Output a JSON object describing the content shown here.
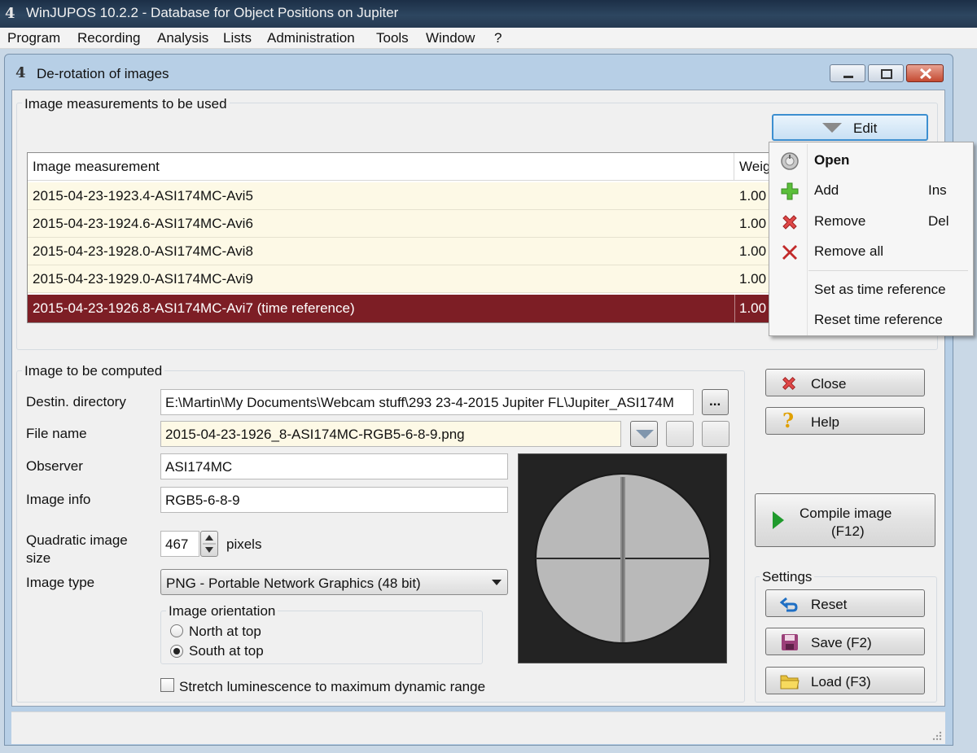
{
  "app": {
    "title": "WinJUPOS 10.2.2 - Database for Object Positions on Jupiter"
  },
  "menubar": [
    "Program",
    "Recording",
    "Analysis",
    "Lists",
    "Administration",
    "Tools",
    "Window",
    "?"
  ],
  "window": {
    "title": "De-rotation of images"
  },
  "measurements": {
    "group_title": "Image measurements to be used",
    "edit_label": "Edit",
    "columns": [
      "Image measurement",
      "Weig"
    ],
    "rows": [
      {
        "name": "2015-04-23-1923.4-ASI174MC-Avi5",
        "weight": "1.00"
      },
      {
        "name": "2015-04-23-1924.6-ASI174MC-Avi6",
        "weight": "1.00"
      },
      {
        "name": "2015-04-23-1928.0-ASI174MC-Avi8",
        "weight": "1.00"
      },
      {
        "name": "2015-04-23-1929.0-ASI174MC-Avi9",
        "weight": "1.00"
      },
      {
        "name": "2015-04-23-1926.8-ASI174MC-Avi7  (time reference)",
        "weight": "1.00"
      }
    ]
  },
  "edit_menu": {
    "items": [
      {
        "label": "Open",
        "shortcut": "",
        "icon": "open-icon"
      },
      {
        "label": "Add",
        "shortcut": "Ins",
        "icon": "plus-icon"
      },
      {
        "label": "Remove",
        "shortcut": "Del",
        "icon": "remove-icon"
      },
      {
        "label": "Remove all",
        "shortcut": "",
        "icon": "remove-all-icon"
      },
      {
        "label": "Set as time reference",
        "shortcut": ""
      },
      {
        "label": "Reset time reference",
        "shortcut": ""
      }
    ]
  },
  "compute": {
    "group_title": "Image to be computed",
    "destin_label": "Destin. directory",
    "destin_value": "E:\\Martin\\My Documents\\Webcam stuff\\293 23-4-2015 Jupiter FL\\Jupiter_ASI174M",
    "browse_label": "...",
    "filename_label": "File name",
    "filename_value": "2015-04-23-1926_8-ASI174MC-RGB5-6-8-9.png",
    "observer_label": "Observer",
    "observer_value": "ASI174MC",
    "imageinfo_label": "Image info",
    "imageinfo_value": "RGB5-6-8-9",
    "size_label_1": "Quadratic image",
    "size_label_2": "size",
    "size_value": "467",
    "size_unit": "pixels",
    "type_label": "Image type",
    "type_value": "PNG  - Portable Network Graphics (48 bit)",
    "orientation_title": "Image orientation",
    "orientation_options": [
      "North at top",
      "South at top"
    ],
    "orientation_selected": 1,
    "stretch_label": "Stretch luminescence to maximum dynamic range",
    "stretch_checked": false
  },
  "buttons": {
    "close": "Close",
    "help": "Help",
    "compile_line1": "Compile image",
    "compile_line2": "(F12)",
    "settings_title": "Settings",
    "reset": "Reset",
    "save": "Save (F2)",
    "load": "Load (F3)"
  },
  "colors": {
    "selected_row": "#7d1e25",
    "row_background": "#fdf9e6",
    "titlebar": "#263a52"
  }
}
